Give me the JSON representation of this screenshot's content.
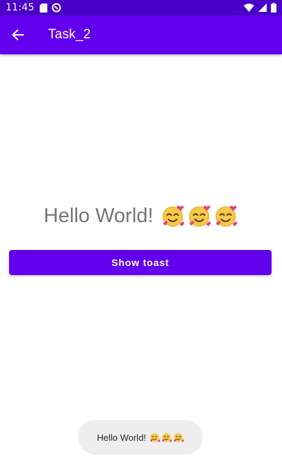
{
  "status_bar": {
    "time": "11:45",
    "left_icons": [
      "sim-card-icon",
      "sync-icon"
    ],
    "right_icons": [
      "wifi-icon",
      "signal-icon",
      "battery-icon"
    ]
  },
  "app_bar": {
    "title": "Task_2",
    "back_icon": "arrow-back-icon",
    "background": "#6200ee"
  },
  "main": {
    "hello_text": "Hello World!",
    "hello_emoji": [
      "smiling-face-with-hearts-icon",
      "smiling-face-with-hearts-icon",
      "smiling-face-with-hearts-icon"
    ],
    "button_label": "Show toast",
    "button_color": "#6200ee"
  },
  "toast": {
    "text": "Hello World!",
    "emoji": [
      "smiling-face-with-hearts-icon",
      "smiling-face-with-hearts-icon",
      "smiling-face-with-hearts-icon"
    ],
    "background": "#eeeeee"
  }
}
